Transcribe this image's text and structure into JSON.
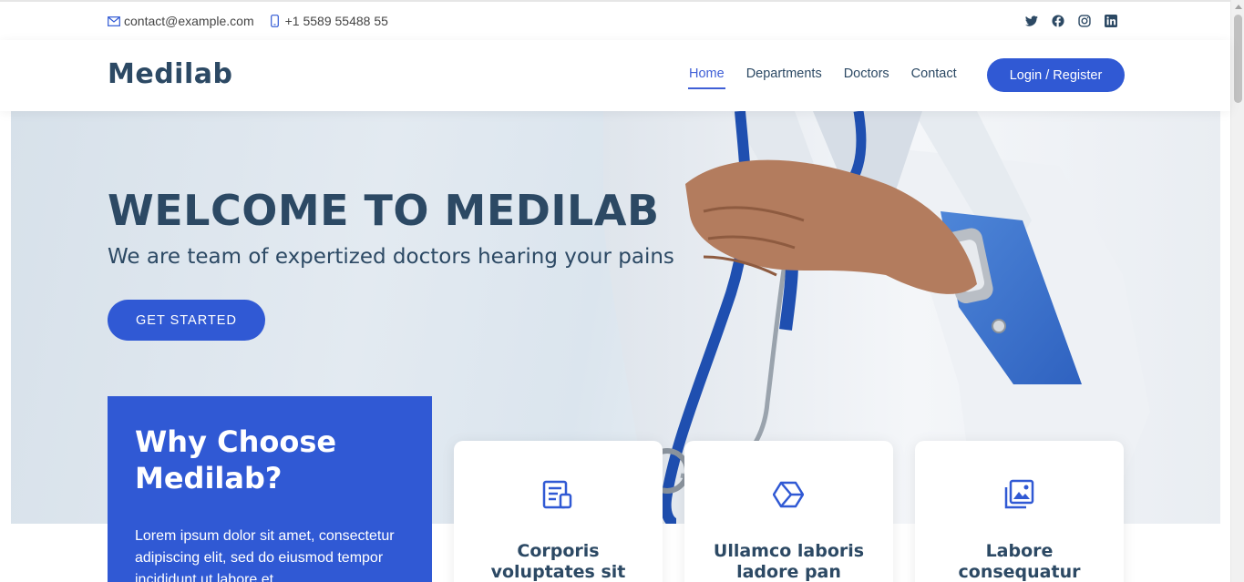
{
  "topbar": {
    "email": "contact@example.com",
    "phone": "+1 5589 55488 55",
    "socials": [
      "twitter-icon",
      "facebook-icon",
      "instagram-icon",
      "linkedin-icon"
    ]
  },
  "header": {
    "logo": "Medilab",
    "nav": [
      "Home",
      "Departments",
      "Doctors",
      "Contact"
    ],
    "active_nav": "Home",
    "login_label": "Login / Register"
  },
  "hero": {
    "title": "WELCOME TO MEDILAB",
    "subtitle": "We are team of expertized doctors hearing your pains",
    "cta_label": "GET STARTED"
  },
  "why": {
    "title": "Why Choose Medilab?",
    "text": "Lorem ipsum dolor sit amet, consectetur adipiscing elit, sed do eiusmod tempor incididunt ut labore et"
  },
  "cards": [
    {
      "icon": "receipt-icon",
      "title": "Corporis voluptates sit"
    },
    {
      "icon": "hexagon-cube-icon",
      "title": "Ullamco laboris ladore pan"
    },
    {
      "icon": "images-icon",
      "title": "Labore consequatur"
    }
  ],
  "colors": {
    "accent": "#3059d4",
    "heading": "#2c4964",
    "text": "#444444"
  }
}
